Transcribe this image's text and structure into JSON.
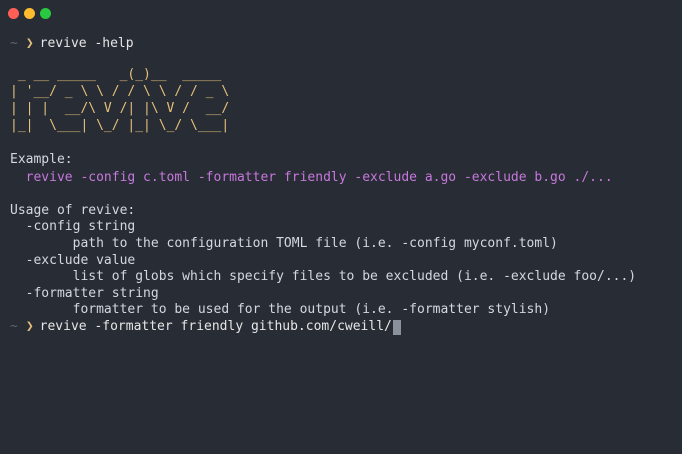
{
  "window": {
    "traffic_lights": [
      {
        "name": "close",
        "color": "#ff5f57"
      },
      {
        "name": "minimize",
        "color": "#febc2e"
      },
      {
        "name": "zoom",
        "color": "#28c840"
      }
    ]
  },
  "terminal": {
    "prompt_symbol": "~",
    "prompt_arrow": "❯",
    "command1": "revive -help",
    "ascii_logo": " _ __ _____   _(_)__  _____\n| '__/ _ \\ \\ / / \\ \\ / / _ \\\n| | |  __/\\ V /| |\\ V /  __/\n|_|  \\___| \\_/ |_| \\_/ \\___|",
    "example_header": "Example:",
    "example_command": "  revive -config c.toml -formatter friendly -exclude a.go -exclude b.go ./...",
    "usage_header": "Usage of revive:",
    "flags": [
      {
        "flag": "  -config string",
        "desc": "        path to the configuration TOML file (i.e. -config myconf.toml)"
      },
      {
        "flag": "  -exclude value",
        "desc": "        list of globs which specify files to be excluded (i.e. -exclude foo/...)"
      },
      {
        "flag": "  -formatter string",
        "desc": "        formatter to be used for the output (i.e. -formatter stylish)"
      }
    ],
    "command2": "revive -formatter friendly github.com/cweill/"
  },
  "colors": {
    "background": "#282c34",
    "logo": "#e5c07b",
    "example": "#c678dd",
    "prompt_arrow": "#e5c07b",
    "text": "#d4d8de"
  }
}
